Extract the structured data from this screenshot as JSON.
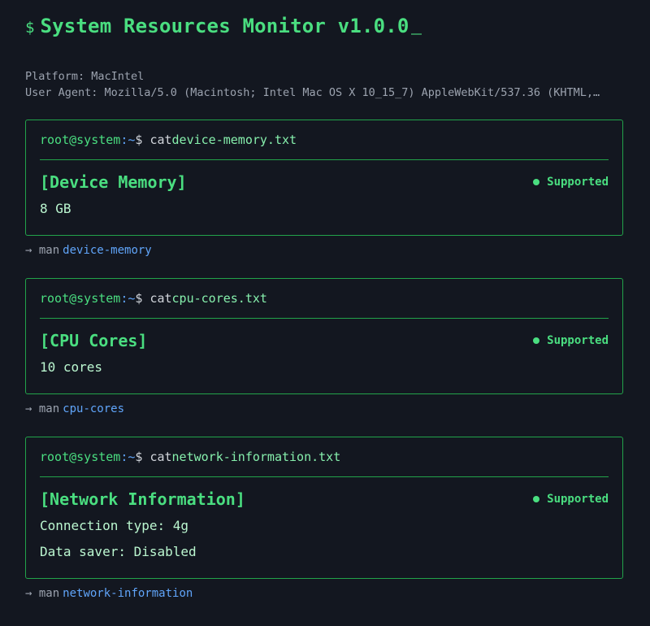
{
  "header": {
    "prompt": "$",
    "title": "System Resources Monitor v1.0.0"
  },
  "system": {
    "platform": "Platform: MacIntel",
    "user_agent": "User Agent: Mozilla/5.0 (Macintosh; Intel Mac OS X 10_15_7) AppleWebKit/537.36 (KHTML,…"
  },
  "prompt": {
    "user_host": "root@system",
    "path": ":~",
    "dollar": "$",
    "command": "cat"
  },
  "cards": [
    {
      "file": "device-memory.txt",
      "title": "[Device Memory]",
      "status": "Supported",
      "values": [
        "8 GB"
      ],
      "man_prefix": "→ man",
      "man_link": "device-memory"
    },
    {
      "file": "cpu-cores.txt",
      "title": "[CPU Cores]",
      "status": "Supported",
      "values": [
        "10 cores"
      ],
      "man_prefix": "→ man",
      "man_link": "cpu-cores"
    },
    {
      "file": "network-information.txt",
      "title": "[Network Information]",
      "status": "Supported",
      "values": [
        "Connection type: 4g",
        "Data saver: Disabled"
      ],
      "man_prefix": "→ man",
      "man_link": "network-information"
    }
  ],
  "colors": {
    "background": "#131720",
    "accent": "#4ade80",
    "border": "#22a34a",
    "link": "#60a5fa"
  }
}
